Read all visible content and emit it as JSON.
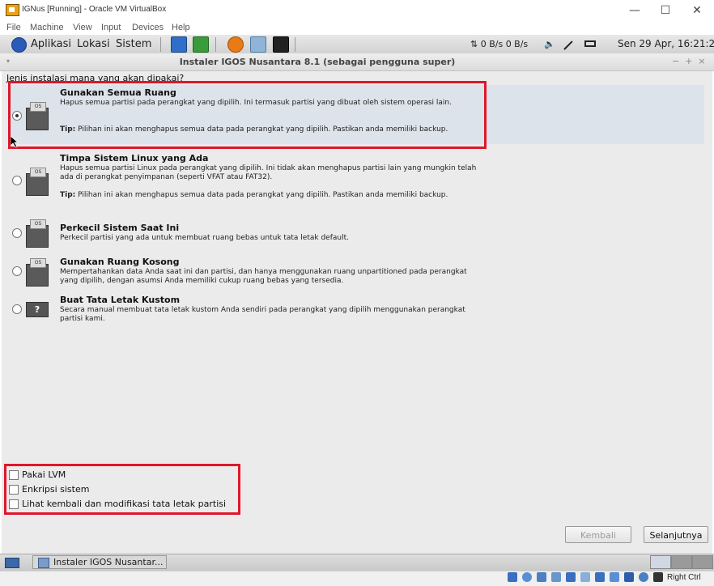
{
  "window": {
    "title": "IGNus [Running] - Oracle VM VirtualBox",
    "min": "—",
    "max": "☐",
    "close": "✕"
  },
  "vbox_menu": [
    "File",
    "Machine",
    "View",
    "Input",
    "Devices",
    "Help"
  ],
  "panel": {
    "menus": [
      "Aplikasi",
      "Lokasi",
      "Sistem"
    ],
    "net": "⇅ 0 B/s 0 B/s",
    "clock": "Sen 29 Apr, 16:21:25"
  },
  "installer": {
    "title": "Instaler IGOS Nusantara 8.1 (sebagai pengguna super)",
    "title_controls": "−  +  ×",
    "question": "Jenis instalasi mana yang akan dipakai?",
    "options": [
      {
        "title": "Gunakan Semua Ruang",
        "desc": "Hapus semua partisi pada perangkat yang dipilih.  Ini termasuk partisi yang dibuat oleh sistem operasi lain.",
        "tip_label": "Tip:",
        "tip": "Pilihan ini akan menghapus semua data pada perangkat yang dipilih.  Pastikan anda memiliki backup.",
        "selected": true
      },
      {
        "title": "Timpa Sistem Linux yang Ada",
        "desc": "Hapus semua partisi Linux pada perangkat yang dipilih. Ini tidak akan menghapus partisi lain yang mungkin telah ada di perangkat penyimpanan (seperti VFAT atau FAT32).",
        "tip_label": "Tip:",
        "tip": "Pilihan ini akan menghapus semua data pada perangkat yang dipilih.  Pastikan anda memiliki backup.",
        "selected": false
      },
      {
        "title": "Perkecil Sistem Saat Ini",
        "desc": "Perkecil partisi yang ada untuk membuat ruang bebas untuk tata letak default.",
        "selected": false
      },
      {
        "title": "Gunakan Ruang Kosong",
        "desc": "Mempertahankan data Anda saat ini dan partisi, dan hanya menggunakan ruang unpartitioned pada perangkat yang dipilih, dengan asumsi Anda memiliki cukup ruang bebas yang tersedia.",
        "selected": false
      },
      {
        "title": "Buat Tata Letak Kustom",
        "desc": "Secara manual membuat tata letak kustom Anda sendiri pada perangkat yang dipilih menggunakan perangkat partisi kami.",
        "selected": false
      }
    ],
    "icon_tag": "OS",
    "custom_icon": "?",
    "checkboxes": [
      "Pakai LVM",
      "Enkripsi sistem",
      "Lihat kembali dan modifikasi tata letak partisi"
    ],
    "back_button": "Kembali",
    "next_button": "Selanjutnya"
  },
  "taskbar": {
    "item": "Instaler IGOS Nusantar..."
  },
  "status": {
    "host_key": "Right Ctrl"
  },
  "colors": {
    "highlight": "#e0162b",
    "selected_row": "#dde3ea"
  }
}
